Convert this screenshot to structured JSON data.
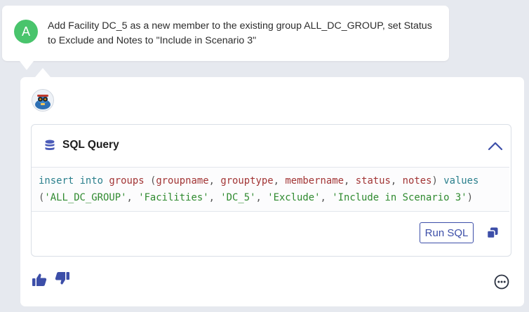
{
  "user_message": {
    "avatar_letter": "A",
    "text": "Add Facility DC_5 as a new member to the existing group ALL_DC_GROUP, set Status to Exclude and Notes to \"Include in Scenario 3\""
  },
  "sql_panel": {
    "title": "SQL Query",
    "code_tokens": {
      "insert": "insert",
      "into": "into",
      "table": "groups",
      "open_paren": " (",
      "col1": "groupname",
      "col2": "grouptype",
      "col3": "membername",
      "col4": "status",
      "col5": "notes",
      "close_paren": ")",
      "values": "values",
      "v1": "'ALL_DC_GROUP'",
      "v2": "'Facilities'",
      "v3": "'DC_5'",
      "v4": "'Exclude'",
      "v5": "'Include in Scenario 3'"
    },
    "run_label": "Run SQL"
  },
  "icons": {
    "user_avatar": "letter-avatar",
    "bot_avatar": "robot-avatar-icon",
    "database": "database-icon",
    "collapse": "chevron-up-icon",
    "copy": "copy-icon",
    "thumbs_up": "thumbs-up-icon",
    "thumbs_down": "thumbs-down-icon",
    "more": "more-options-icon"
  },
  "colors": {
    "accent": "#3c4ea8",
    "keyword": "#2a7f8c",
    "identifier": "#a23535",
    "string": "#2f8a2f",
    "avatar_green": "#49c46c",
    "background": "#e6e9ef"
  }
}
